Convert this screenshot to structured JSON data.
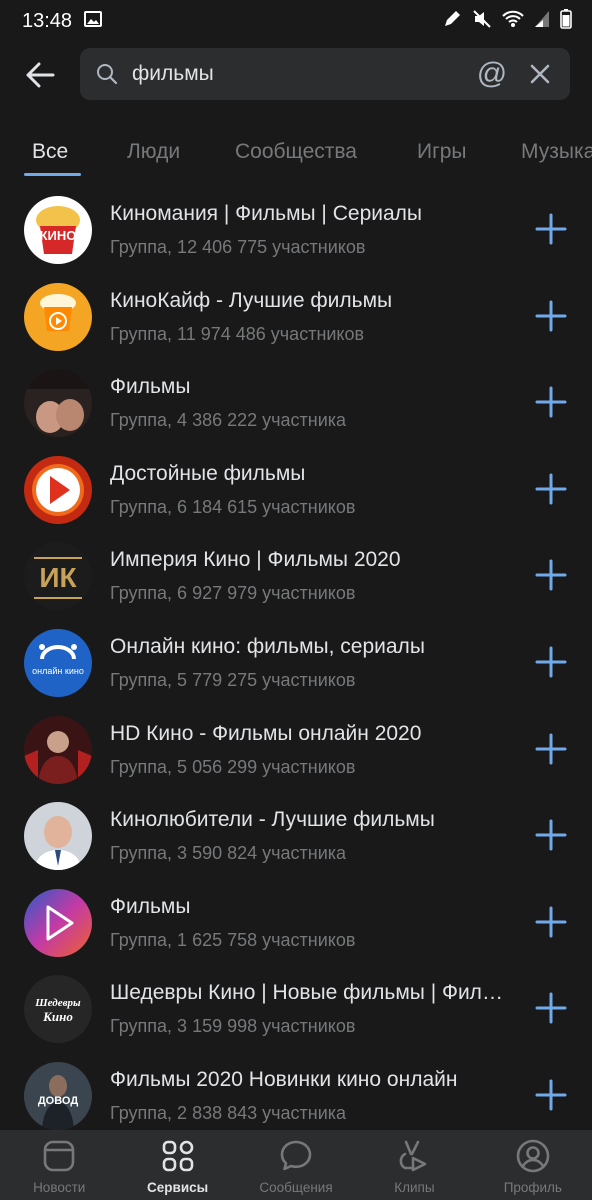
{
  "status": {
    "time": "13:48"
  },
  "search": {
    "query": "фильмы",
    "at_symbol": "@"
  },
  "tabs": [
    {
      "label": "Все"
    },
    {
      "label": "Люди"
    },
    {
      "label": "Сообщества"
    },
    {
      "label": "Игры"
    },
    {
      "label": "Музыка"
    }
  ],
  "results": [
    {
      "title": "Киномания | Фильмы | Сериалы",
      "subtitle": "Группа, 12 406 775 участников",
      "avatar_text": "КИНО"
    },
    {
      "title": "КиноКайф - Лучшие фильмы",
      "subtitle": "Группа, 11 974 486 участников"
    },
    {
      "title": "Фильмы",
      "subtitle": "Группа, 4 386 222 участника"
    },
    {
      "title": "Достойные фильмы",
      "subtitle": "Группа, 6 184 615 участников"
    },
    {
      "title": "Империя Кино | Фильмы 2020",
      "subtitle": "Группа, 6 927 979 участников",
      "avatar_text": "ИК"
    },
    {
      "title": "Онлайн кино: фильмы, сериалы",
      "subtitle": "Группа, 5 779 275 участников",
      "avatar_text": "онлайн кино"
    },
    {
      "title": "HD Кино - Фильмы онлайн 2020",
      "subtitle": "Группа, 5 056 299 участников"
    },
    {
      "title": "Кинолюбители - Лучшие фильмы",
      "subtitle": "Группа, 3 590 824 участника"
    },
    {
      "title": "Фильмы",
      "subtitle": "Группа, 1 625 758 участников"
    },
    {
      "title": "Шедевры Кино | Новые фильмы | Фильмы",
      "subtitle": "Группа, 3 159 998 участников",
      "avatar_text": "Шедевры Кино"
    },
    {
      "title": "Фильмы 2020 Новинки кино онлайн",
      "subtitle": "Группа, 2 838 843 участника",
      "avatar_text": "ДОВОД"
    }
  ],
  "bottom_nav": [
    {
      "label": "Новости",
      "icon": "news-icon"
    },
    {
      "label": "Сервисы",
      "icon": "services-icon"
    },
    {
      "label": "Сообщения",
      "icon": "messages-icon"
    },
    {
      "label": "Клипы",
      "icon": "clips-icon"
    },
    {
      "label": "Профиль",
      "icon": "profile-icon"
    }
  ],
  "colors": {
    "background": "#19191a",
    "surface": "#2c2d2e",
    "accent": "#71aaeb",
    "text": "#e1e3e6",
    "secondary": "#76787a"
  }
}
